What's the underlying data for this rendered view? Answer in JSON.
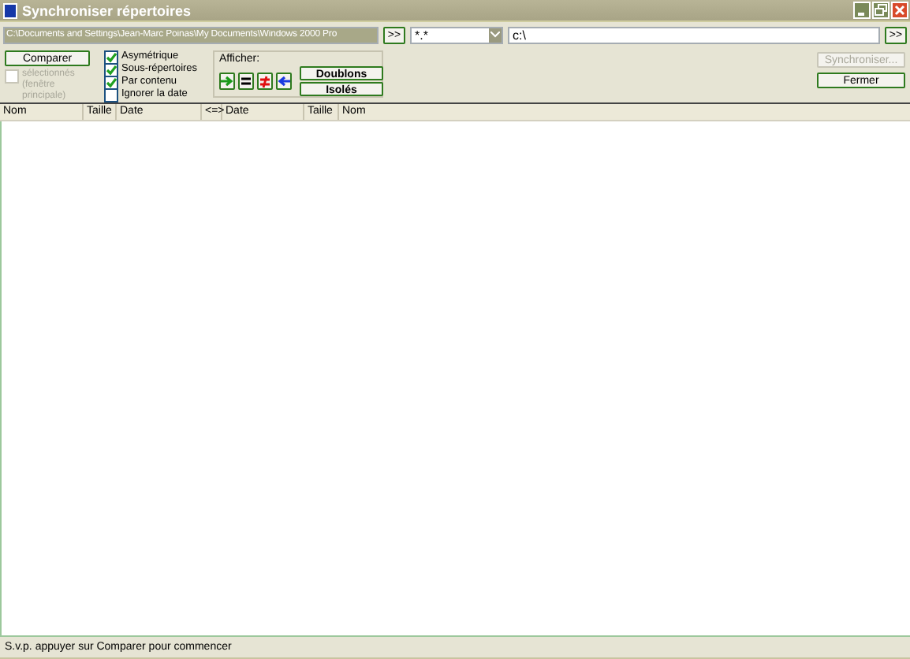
{
  "window": {
    "title": "Synchroniser répertoires"
  },
  "left_path": {
    "value": "C:\\Documents and Settings\\Jean-Marc Poinas\\My Documents\\Windows 2000 Pro",
    "selected": true
  },
  "left_browse": ">>",
  "filter": {
    "value": "*.*"
  },
  "right_path": {
    "value": "c:\\"
  },
  "right_browse": ">>",
  "compare_button": "Comparer",
  "selected_only": {
    "label": "sélectionnés (fenêtre principale)",
    "checked": false,
    "disabled": true
  },
  "options": [
    {
      "label": "Asymétrique",
      "checked": true
    },
    {
      "label": "Sous-répertoires",
      "checked": true
    },
    {
      "label": "Par contenu",
      "checked": true
    },
    {
      "label": "Ignorer la date",
      "checked": false
    }
  ],
  "show_group": {
    "title": "Afficher:",
    "toggles": [
      {
        "kind": "right"
      },
      {
        "kind": "equal"
      },
      {
        "kind": "notequal"
      },
      {
        "kind": "left"
      }
    ],
    "buttons": [
      "Doublons",
      "Isolés"
    ]
  },
  "sync_button": {
    "label": "Synchroniser...",
    "disabled": true
  },
  "close_button": "Fermer",
  "columns": [
    "Nom",
    "Taille",
    "Date",
    "<=>",
    "Date",
    "Taille",
    "Nom"
  ],
  "status_bar": "S.v.p. appuyer sur Comparer pour commencer"
}
